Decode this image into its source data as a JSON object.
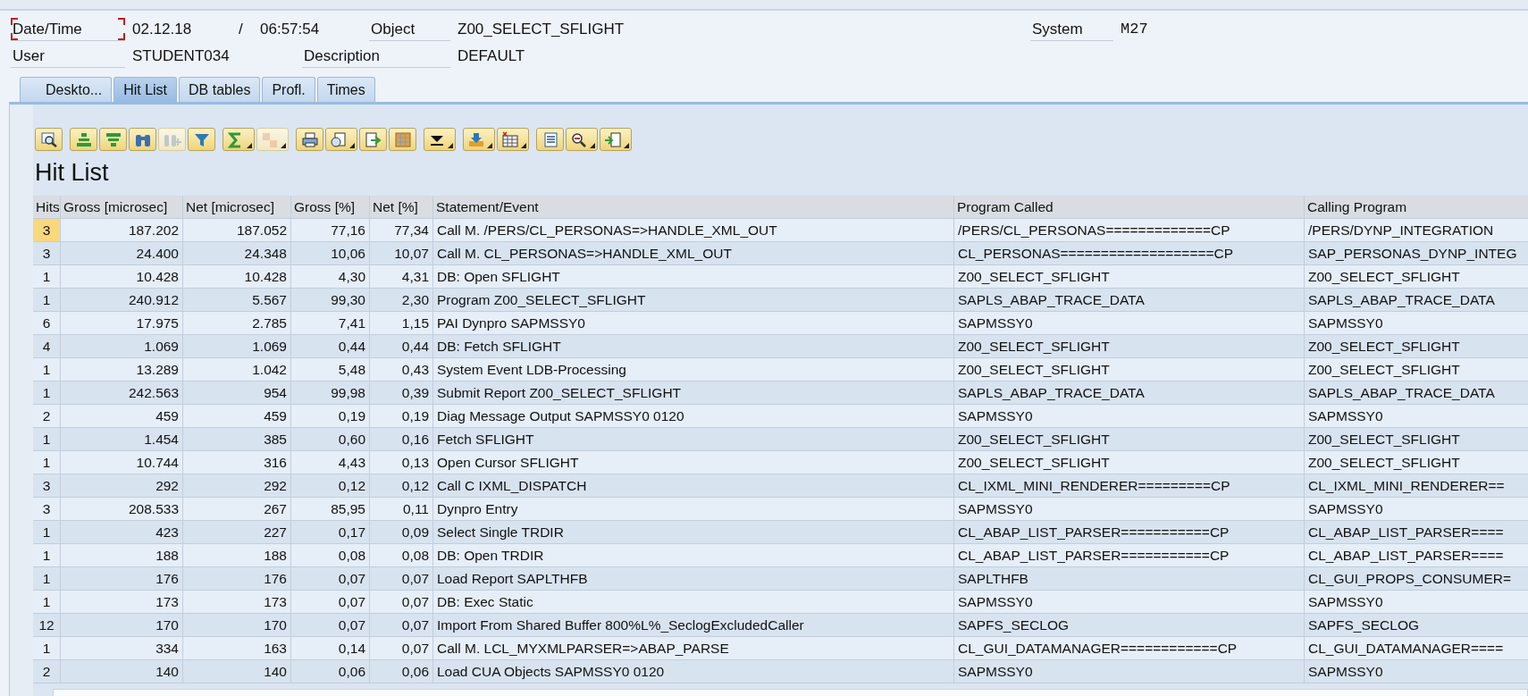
{
  "header": {
    "date_time": {
      "label": "Date/Time",
      "focused": true,
      "date": "02.12.18",
      "separator": "/",
      "time": "06:57:54"
    },
    "object": {
      "label": "Object",
      "value": "Z00_SELECT_SFLIGHT"
    },
    "system": {
      "label": "System",
      "value": "M27"
    },
    "user": {
      "label": "User",
      "value": "STUDENT034"
    },
    "description": {
      "label": "Description",
      "value": "DEFAULT"
    }
  },
  "tabs": [
    {
      "label": "Deskto...",
      "selected": false
    },
    {
      "label": "Hit List",
      "selected": true
    },
    {
      "label": "DB tables",
      "selected": false
    },
    {
      "label": "Profl.",
      "selected": false
    },
    {
      "label": "Times",
      "selected": false
    }
  ],
  "toolbar": {
    "groups": [
      {
        "buttons": [
          {
            "menu": false,
            "disabled": false
          }
        ]
      },
      {
        "buttons": [
          {
            "menu": false,
            "disabled": false
          },
          {
            "menu": false,
            "disabled": false
          },
          {
            "menu": false,
            "disabled": false
          },
          {
            "menu": false,
            "disabled": true
          },
          {
            "menu": false,
            "disabled": false
          }
        ]
      },
      {
        "buttons": [
          {
            "menu": true,
            "disabled": false
          },
          {
            "menu": true,
            "disabled": true
          }
        ]
      },
      {
        "buttons": [
          {
            "menu": false,
            "disabled": false
          },
          {
            "menu": true,
            "disabled": false
          },
          {
            "menu": false,
            "disabled": false
          },
          {
            "menu": false,
            "disabled": false
          }
        ]
      },
      {
        "buttons": [
          {
            "menu": true,
            "disabled": false
          }
        ]
      },
      {
        "buttons": [
          {
            "menu": true,
            "disabled": false
          },
          {
            "menu": true,
            "disabled": false
          }
        ]
      },
      {
        "buttons": [
          {
            "menu": false,
            "disabled": false
          },
          {
            "menu": true,
            "disabled": false
          },
          {
            "menu": true,
            "disabled": false
          }
        ]
      }
    ]
  },
  "hit_list": {
    "title": "Hit List",
    "columns": [
      "Hits",
      "Gross [microsec]",
      "Net [microsec]",
      "Gross [%]",
      "Net [%]",
      "Statement/Event",
      "Program Called",
      "Calling Program"
    ],
    "rows": [
      {
        "selected": true,
        "cells": [
          "3",
          "187.202",
          "187.052",
          "77,16",
          "77,34",
          "Call M. /PERS/CL_PERSONAS=>HANDLE_XML_OUT",
          "/PERS/CL_PERSONAS=============CP",
          "/PERS/DYNP_INTEGRATION"
        ]
      },
      {
        "selected": false,
        "cells": [
          "3",
          "24.400",
          "24.348",
          "10,06",
          "10,07",
          "Call M. CL_PERSONAS=>HANDLE_XML_OUT",
          "CL_PERSONAS===================CP",
          "SAP_PERSONAS_DYNP_INTEG"
        ]
      },
      {
        "selected": false,
        "cells": [
          "1",
          "10.428",
          "10.428",
          "4,30",
          "4,31",
          "DB: Open SFLIGHT",
          "Z00_SELECT_SFLIGHT",
          "Z00_SELECT_SFLIGHT"
        ]
      },
      {
        "selected": false,
        "cells": [
          "1",
          "240.912",
          "5.567",
          "99,30",
          "2,30",
          "Program Z00_SELECT_SFLIGHT",
          "SAPLS_ABAP_TRACE_DATA",
          "SAPLS_ABAP_TRACE_DATA"
        ]
      },
      {
        "selected": false,
        "cells": [
          "6",
          "17.975",
          "2.785",
          "7,41",
          "1,15",
          "PAI Dynpro SAPMSSY0",
          "SAPMSSY0",
          "SAPMSSY0"
        ]
      },
      {
        "selected": false,
        "cells": [
          "4",
          "1.069",
          "1.069",
          "0,44",
          "0,44",
          "DB: Fetch SFLIGHT",
          "Z00_SELECT_SFLIGHT",
          "Z00_SELECT_SFLIGHT"
        ]
      },
      {
        "selected": false,
        "cells": [
          "1",
          "13.289",
          "1.042",
          "5,48",
          "0,43",
          "System Event LDB-Processing",
          "Z00_SELECT_SFLIGHT",
          "Z00_SELECT_SFLIGHT"
        ]
      },
      {
        "selected": false,
        "cells": [
          "1",
          "242.563",
          "954",
          "99,98",
          "0,39",
          "Submit Report Z00_SELECT_SFLIGHT",
          "SAPLS_ABAP_TRACE_DATA",
          "SAPLS_ABAP_TRACE_DATA"
        ]
      },
      {
        "selected": false,
        "cells": [
          "2",
          "459",
          "459",
          "0,19",
          "0,19",
          "Diag Message Output SAPMSSY0 0120",
          "SAPMSSY0",
          "SAPMSSY0"
        ]
      },
      {
        "selected": false,
        "cells": [
          "1",
          "1.454",
          "385",
          "0,60",
          "0,16",
          "Fetch SFLIGHT",
          "Z00_SELECT_SFLIGHT",
          "Z00_SELECT_SFLIGHT"
        ]
      },
      {
        "selected": false,
        "cells": [
          "1",
          "10.744",
          "316",
          "4,43",
          "0,13",
          "Open Cursor SFLIGHT",
          "Z00_SELECT_SFLIGHT",
          "Z00_SELECT_SFLIGHT"
        ]
      },
      {
        "selected": false,
        "cells": [
          "3",
          "292",
          "292",
          "0,12",
          "0,12",
          "Call C IXML_DISPATCH",
          "CL_IXML_MINI_RENDERER=========CP",
          "CL_IXML_MINI_RENDERER=="
        ]
      },
      {
        "selected": false,
        "cells": [
          "3",
          "208.533",
          "267",
          "85,95",
          "0,11",
          "Dynpro Entry",
          "SAPMSSY0",
          "SAPMSSY0"
        ]
      },
      {
        "selected": false,
        "cells": [
          "1",
          "423",
          "227",
          "0,17",
          "0,09",
          "Select Single TRDIR",
          "CL_ABAP_LIST_PARSER===========CP",
          "CL_ABAP_LIST_PARSER===="
        ]
      },
      {
        "selected": false,
        "cells": [
          "1",
          "188",
          "188",
          "0,08",
          "0,08",
          "DB: Open TRDIR",
          "CL_ABAP_LIST_PARSER===========CP",
          "CL_ABAP_LIST_PARSER===="
        ]
      },
      {
        "selected": false,
        "cells": [
          "1",
          "176",
          "176",
          "0,07",
          "0,07",
          "Load Report SAPLTHFB",
          "SAPLTHFB",
          "CL_GUI_PROPS_CONSUMER="
        ]
      },
      {
        "selected": false,
        "cells": [
          "1",
          "173",
          "173",
          "0,07",
          "0,07",
          "DB: Exec Static",
          "SAPMSSY0",
          "SAPMSSY0"
        ]
      },
      {
        "selected": false,
        "cells": [
          "12",
          "170",
          "170",
          "0,07",
          "0,07",
          "Import From Shared Buffer 800%L%_SeclogExcludedCaller",
          "SAPFS_SECLOG",
          "SAPFS_SECLOG"
        ]
      },
      {
        "selected": false,
        "cells": [
          "1",
          "334",
          "163",
          "0,14",
          "0,07",
          "Call M. LCL_MYXMLPARSER=>ABAP_PARSE",
          "CL_GUI_DATAMANAGER============CP",
          "CL_GUI_DATAMANAGER===="
        ]
      },
      {
        "selected": false,
        "cells": [
          "2",
          "140",
          "140",
          "0,06",
          "0,06",
          "Load CUA Objects SAPMSSY0 0120",
          "SAPMSSY0",
          "SAPMSSY0"
        ]
      }
    ]
  }
}
